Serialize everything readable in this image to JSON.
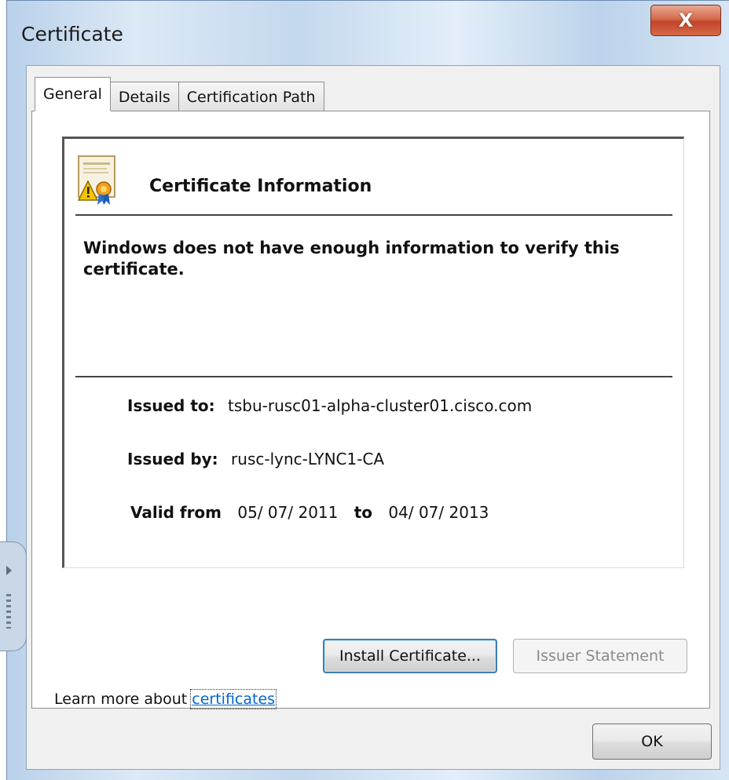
{
  "window": {
    "title": "Certificate",
    "close_label": "X"
  },
  "tabs": [
    {
      "label": "General",
      "active": true
    },
    {
      "label": "Details",
      "active": false
    },
    {
      "label": "Certification Path",
      "active": false
    }
  ],
  "info": {
    "header": "Certificate Information",
    "icon": "certificate-warning-icon",
    "warning": "Windows does not have enough information to verify this certificate.",
    "issued_to_label": "Issued to:",
    "issued_to_value": "tsbu-rusc01-alpha-cluster01.cisco.com",
    "issued_by_label": "Issued by:",
    "issued_by_value": "rusc-lync-LYNC1-CA",
    "valid_from_label": "Valid from",
    "valid_from_value": "05/ 07/ 2011",
    "valid_to_label": "to",
    "valid_to_value": "04/ 07/ 2013"
  },
  "buttons": {
    "install": "Install Certificate...",
    "issuer_statement": "Issuer Statement",
    "ok": "OK"
  },
  "learn_more": {
    "prefix": "Learn more about ",
    "link": "certificates"
  },
  "colors": {
    "link": "#0066cc",
    "close_button": "#c2452a",
    "focus_border": "#3c7fb1"
  }
}
